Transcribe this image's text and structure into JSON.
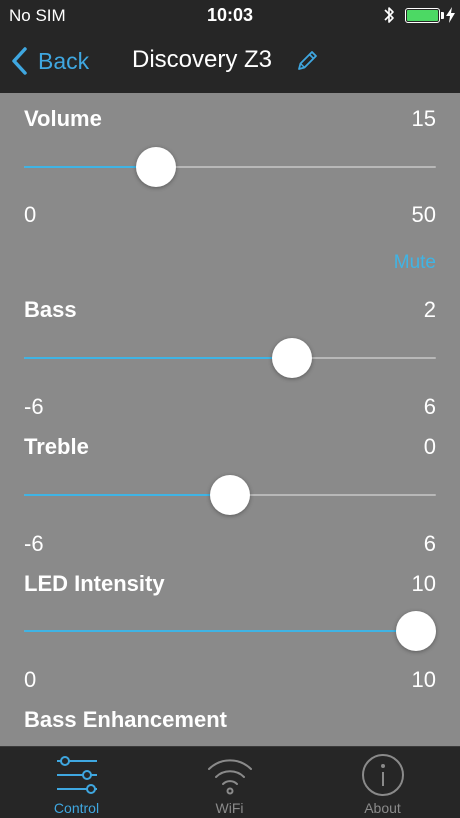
{
  "status_bar": {
    "carrier": "No SIM",
    "time": "10:03",
    "battery_charging": true
  },
  "nav": {
    "back_label": "Back",
    "title": "Discovery Z3"
  },
  "controls": {
    "volume": {
      "label": "Volume",
      "value": "15",
      "min": "0",
      "max": "50",
      "mute_label": "Mute"
    },
    "bass": {
      "label": "Bass",
      "value": "2",
      "min": "-6",
      "max": "6"
    },
    "treble": {
      "label": "Treble",
      "value": "0",
      "min": "-6",
      "max": "6"
    },
    "led_intensity": {
      "label": "LED Intensity",
      "value": "10",
      "min": "0",
      "max": "10"
    },
    "bass_enhancement": {
      "label": "Bass Enhancement"
    }
  },
  "tabs": [
    {
      "label": "Control",
      "icon": "sliders-icon",
      "active": true
    },
    {
      "label": "WiFi",
      "icon": "wifi-icon",
      "active": false
    },
    {
      "label": "About",
      "icon": "info-icon",
      "active": false
    }
  ],
  "colors": {
    "accent": "#3fb4e5",
    "background": "#8a8a8a",
    "bars": "#262626",
    "battery": "#4cd964"
  }
}
